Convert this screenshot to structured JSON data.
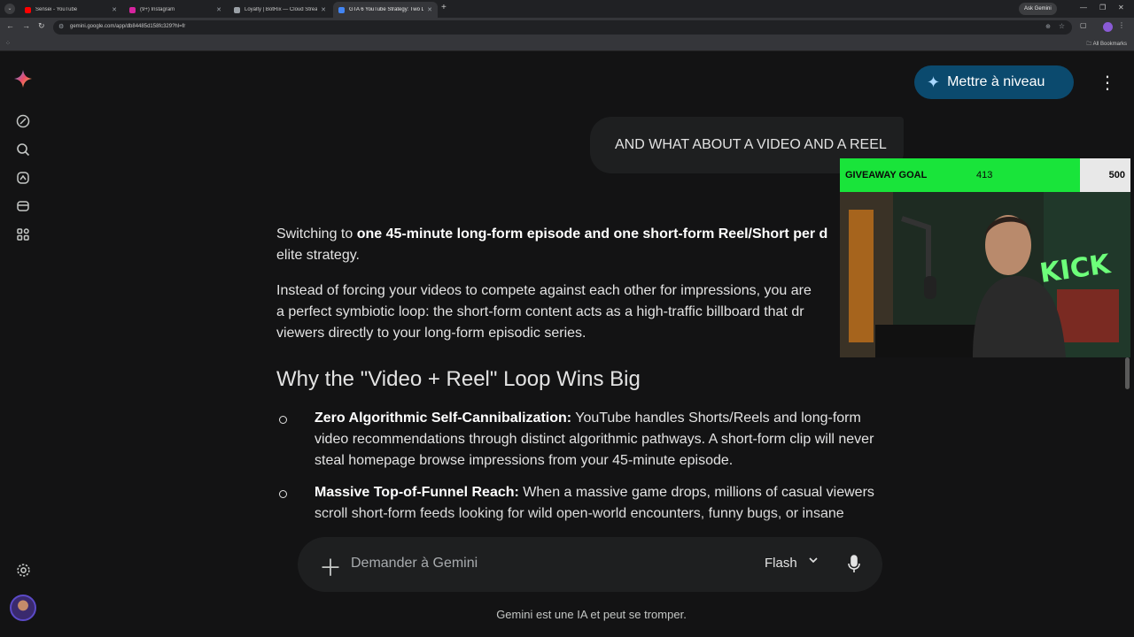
{
  "browser": {
    "tabs": [
      {
        "title": "Sensei - YouTube",
        "favicon_color": "#ff0000"
      },
      {
        "title": "(9+) Instagram",
        "favicon_color": "#d6249f"
      },
      {
        "title": "Loyalty | BotRix — Cloud Stream",
        "favicon_color": "#9aa0a6"
      },
      {
        "title": "GTA 6 YouTube Strategy: Two L",
        "favicon_color": "#4285f4"
      }
    ],
    "ask_gemini": "Ask Gemini",
    "url": "gemini.google.com/app/db84485d158fc329?hl=fr",
    "all_bookmarks": "All Bookmarks"
  },
  "header": {
    "upgrade_label": "Mettre à niveau"
  },
  "conversation": {
    "user_message": "AND WHAT ABOUT A VIDEO AND A REEL",
    "p1_pre": "Switching to ",
    "p1_bold": "one 45-minute long-form episode and one short-form Reel/Short per d",
    "p1_line2": "elite strategy.",
    "p2": "Instead of forcing your videos to compete against each other for impressions, you are",
    "p2_line2": "a perfect symbiotic loop: the short-form content acts as a high-traffic billboard that dr",
    "p2_line3": "viewers directly to your long-form episodic series.",
    "heading": "Why the \"Video + Reel\" Loop Wins Big",
    "bullets": [
      {
        "title": "Zero Algorithmic Self-Cannibalization:",
        "text": " YouTube handles Shorts/Reels and long-form video recommendations through distinct algorithmic pathways. A short-form clip will never steal homepage browse impressions from your 45-minute episode."
      },
      {
        "title": "Massive Top-of-Funnel Reach:",
        "text": " When a massive game drops, millions of casual viewers scroll short-form feeds looking for wild open-world encounters, funny bugs, or insane"
      }
    ]
  },
  "composer": {
    "placeholder": "Demander à Gemini",
    "model": "Flash"
  },
  "disclaimer": "Gemini est une IA et peut se tromper.",
  "overlay": {
    "goal_label": "GIVEAWAY GOAL",
    "goal_current": "413",
    "goal_max": "500",
    "goal_progress": 0.826,
    "goal_fill_color": "#19e43a",
    "neon_sign": "KICK"
  }
}
